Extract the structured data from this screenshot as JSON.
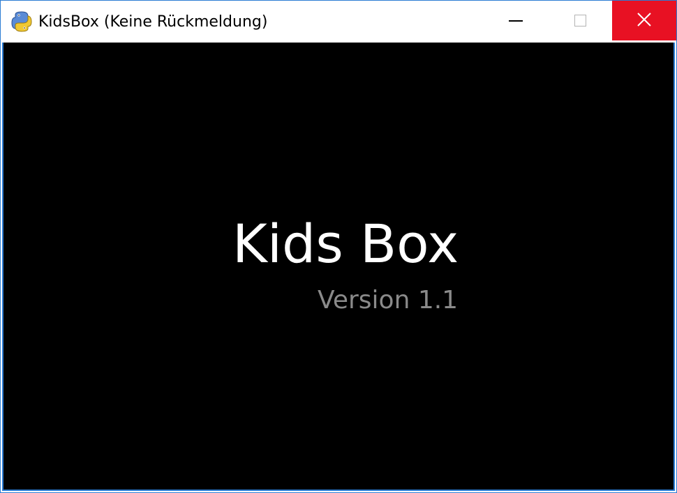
{
  "window": {
    "title": "KidsBox (Keine Rückmeldung)",
    "app_icon": "python-snake-icon",
    "controls": {
      "minimize_icon": "minimize-icon",
      "maximize_icon": "maximize-icon",
      "close_icon": "close-icon"
    },
    "colors": {
      "border": "#2b7cd3",
      "close_bg": "#e81123",
      "client_bg": "#000000"
    }
  },
  "splash": {
    "title": "Kids Box",
    "version": "Version 1.1",
    "colors": {
      "title": "#ffffff",
      "version": "#8a8a8a"
    }
  }
}
